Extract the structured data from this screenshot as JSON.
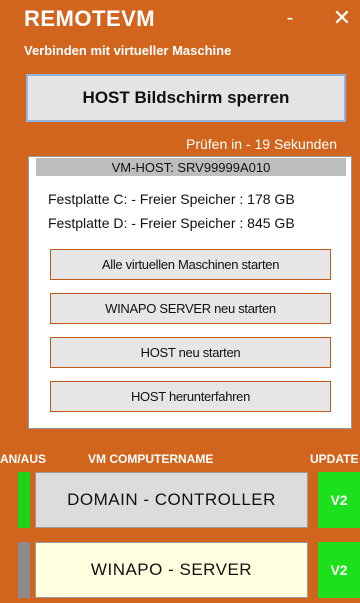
{
  "app": {
    "title": "REMOTEVM",
    "subtitle": "Verbinden mit virtueller Maschine",
    "minimize_glyph": "-",
    "close_glyph": "✕"
  },
  "host_lock_button": "HOST Bildschirm sperren",
  "check_timer": "Prüfen in - 19 Sekunden",
  "vm_host": {
    "label": "VM-HOST: SRV99999A010",
    "disk_c": "Festplatte C: - Freier Speicher : 178 GB",
    "disk_d": "Festplatte D: - Freier Speicher : 845 GB",
    "actions": [
      "Alle virtuellen Maschinen starten",
      "WINAPO SERVER neu starten",
      "HOST neu starten",
      "HOST herunterfahren"
    ]
  },
  "vm_table": {
    "headers": {
      "onoff": "AN/AUS",
      "name": "VM COMPUTERNAME",
      "update": "UPDATE"
    },
    "rows": [
      {
        "name": "DOMAIN - CONTROLLER",
        "update": "V2",
        "status_color": "#1AD21A"
      },
      {
        "name": "WINAPO - SERVER",
        "update": "V2",
        "status_color": "#8C8C8C"
      }
    ]
  },
  "colors": {
    "background": "#D2651E",
    "accent_border": "#8DB3E2",
    "update_green": "#1BE01B"
  }
}
